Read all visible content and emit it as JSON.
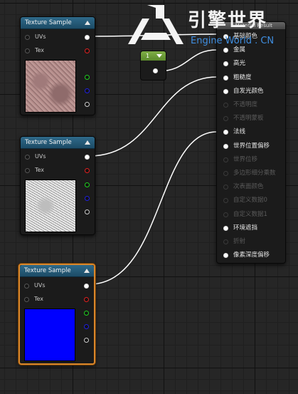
{
  "nodes": {
    "texture_sample_1": {
      "title": "Texture Sample",
      "pins": [
        "UVs",
        "Tex"
      ]
    },
    "texture_sample_2": {
      "title": "Texture Sample",
      "pins": [
        "UVs",
        "Tex"
      ]
    },
    "texture_sample_3": {
      "title": "Texture Sample",
      "pins": [
        "UVs",
        "Tex"
      ]
    },
    "constant": {
      "value": "1"
    }
  },
  "result_node": {
    "title": "Material Result",
    "inputs": [
      {
        "label": "基础颜色",
        "enabled": true
      },
      {
        "label": "金属",
        "enabled": true
      },
      {
        "label": "高光",
        "enabled": true
      },
      {
        "label": "粗糙度",
        "enabled": true
      },
      {
        "label": "自发光颜色",
        "enabled": true
      },
      {
        "label": "不透明度",
        "enabled": false
      },
      {
        "label": "不透明蒙板",
        "enabled": false
      },
      {
        "label": "法线",
        "enabled": true
      },
      {
        "label": "世界位置偏移",
        "enabled": true
      },
      {
        "label": "世界位移",
        "enabled": false
      },
      {
        "label": "多边形细分乘数",
        "enabled": false
      },
      {
        "label": "次表面颜色",
        "enabled": false
      },
      {
        "label": "自定义数据0",
        "enabled": false
      },
      {
        "label": "自定义数据1",
        "enabled": false
      },
      {
        "label": "环境遮挡",
        "enabled": true
      },
      {
        "label": "折射",
        "enabled": false
      },
      {
        "label": "像素深度偏移",
        "enabled": true
      }
    ]
  },
  "watermark": {
    "title": "引擎世界",
    "subtitle": "Engine World . CN"
  },
  "colors": {
    "pin_red": "#e02020",
    "pin_green": "#20d020",
    "pin_blue": "#2020e0",
    "selected_border": "#d9862a",
    "header": "#2f6a8a"
  }
}
